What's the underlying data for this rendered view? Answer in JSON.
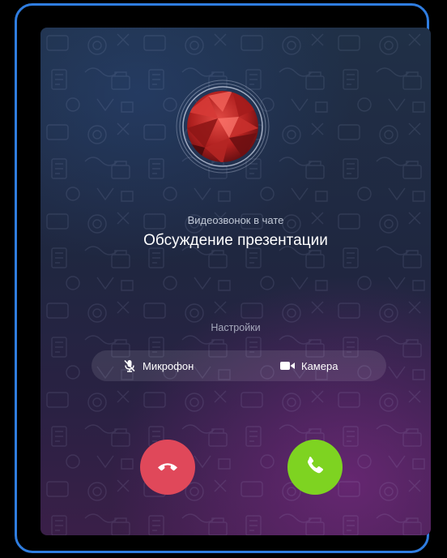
{
  "call": {
    "subtitle": "Видеозвонок в чате",
    "title": "Обсуждение презентации"
  },
  "settings": {
    "label": "Настройки",
    "microphone": {
      "label": "Микрофон",
      "icon": "microphone-off-icon",
      "enabled": false
    },
    "camera": {
      "label": "Камера",
      "icon": "video-camera-icon",
      "enabled": true
    }
  },
  "actions": {
    "decline": {
      "icon": "phone-hangup-icon",
      "color": "#e0485a"
    },
    "accept": {
      "icon": "phone-icon",
      "color": "#7ed321"
    }
  },
  "colors": {
    "frame_border": "#2f7de0",
    "avatar_red": "#c62828"
  }
}
